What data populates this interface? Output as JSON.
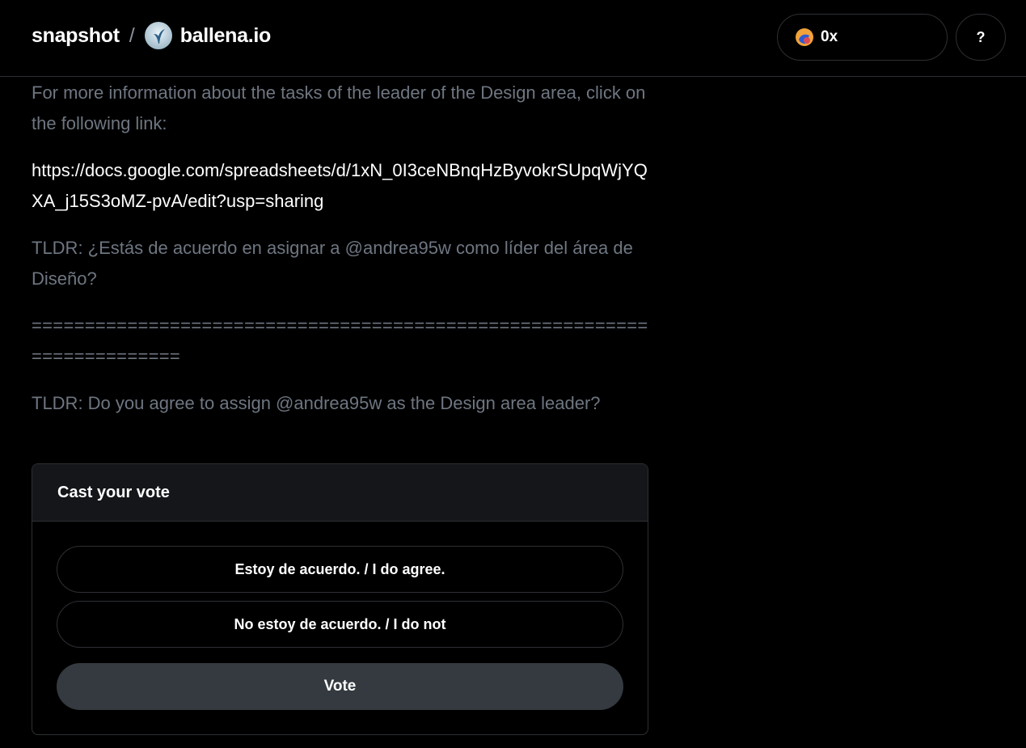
{
  "header": {
    "brand": "snapshot",
    "separator": "/",
    "space_name": "ballena.io",
    "space_avatar_icon": "whale-tail-icon",
    "account_label": "0x",
    "account_avatar_icon": "wallet-avatar-icon",
    "help_label": "?"
  },
  "proposal": {
    "paragraph_info": "For more information about the tasks of the leader of the Design area, click on the following link:",
    "link": "https://docs.google.com/spreadsheets/d/1xN_0I3ceNBnqHzByvokrSUpqWjYQXA_j15S3oMZ-pvA/edit?usp=sharing",
    "tldr_es": "TLDR: ¿Estás de acuerdo en asignar a @andrea95w como líder del área de Diseño?",
    "divider": "========================================================================",
    "tldr_en": "TLDR: Do you agree to assign @andrea95w as the Design area leader?"
  },
  "vote": {
    "title": "Cast your vote",
    "choices": [
      "Estoy de acuerdo. / I do agree.",
      "No estoy de acuerdo. / I do not"
    ],
    "submit_label": "Vote"
  },
  "colors": {
    "background": "#000000",
    "muted_text": "#6e7681",
    "border": "#2d2f33",
    "card_header": "#141619",
    "vote_button": "#343a40"
  }
}
